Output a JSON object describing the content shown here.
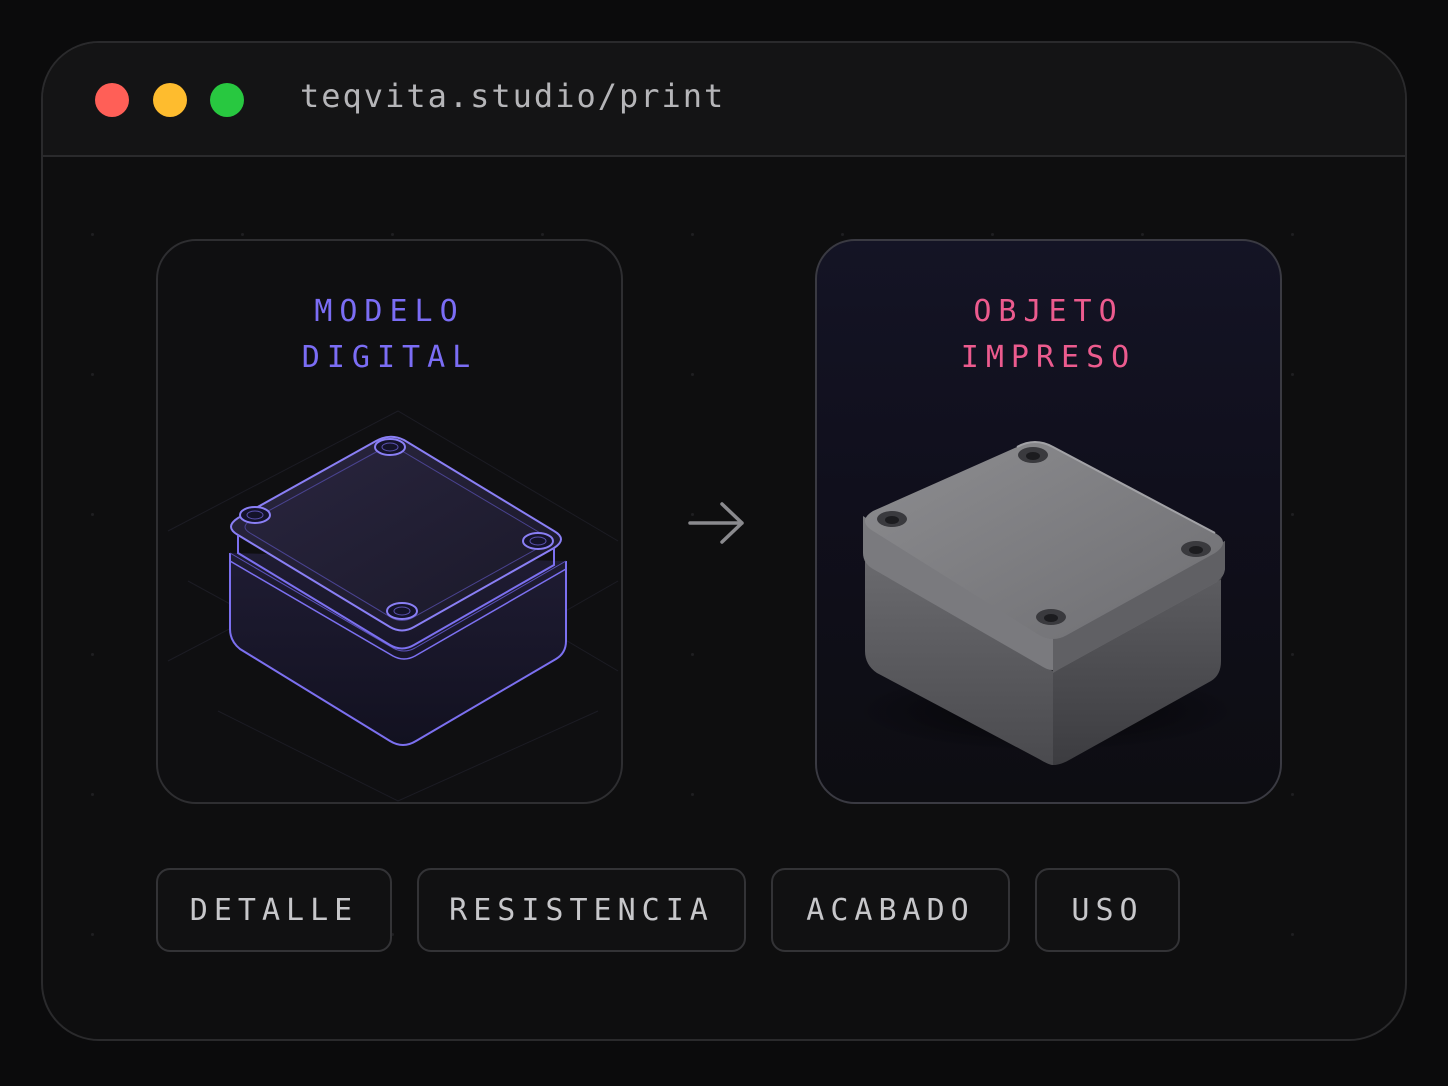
{
  "window": {
    "url": "teqvita.studio/print"
  },
  "cards": {
    "digital": {
      "title_line1": "MODELO",
      "title_line2": "DIGITAL",
      "accent": "#7b6df5"
    },
    "printed": {
      "title_line1": "OBJETO",
      "title_line2": "IMPRESO",
      "accent": "#ec5b8e"
    }
  },
  "tags": [
    "DETALLE",
    "RESISTENCIA",
    "ACABADO",
    "USO"
  ],
  "icons": {
    "transition": "arrow-right-icon"
  },
  "colors": {
    "background": "#0b0b0c",
    "traffic_red": "#ff5f57",
    "traffic_yellow": "#febc2e",
    "traffic_green": "#28c840"
  }
}
